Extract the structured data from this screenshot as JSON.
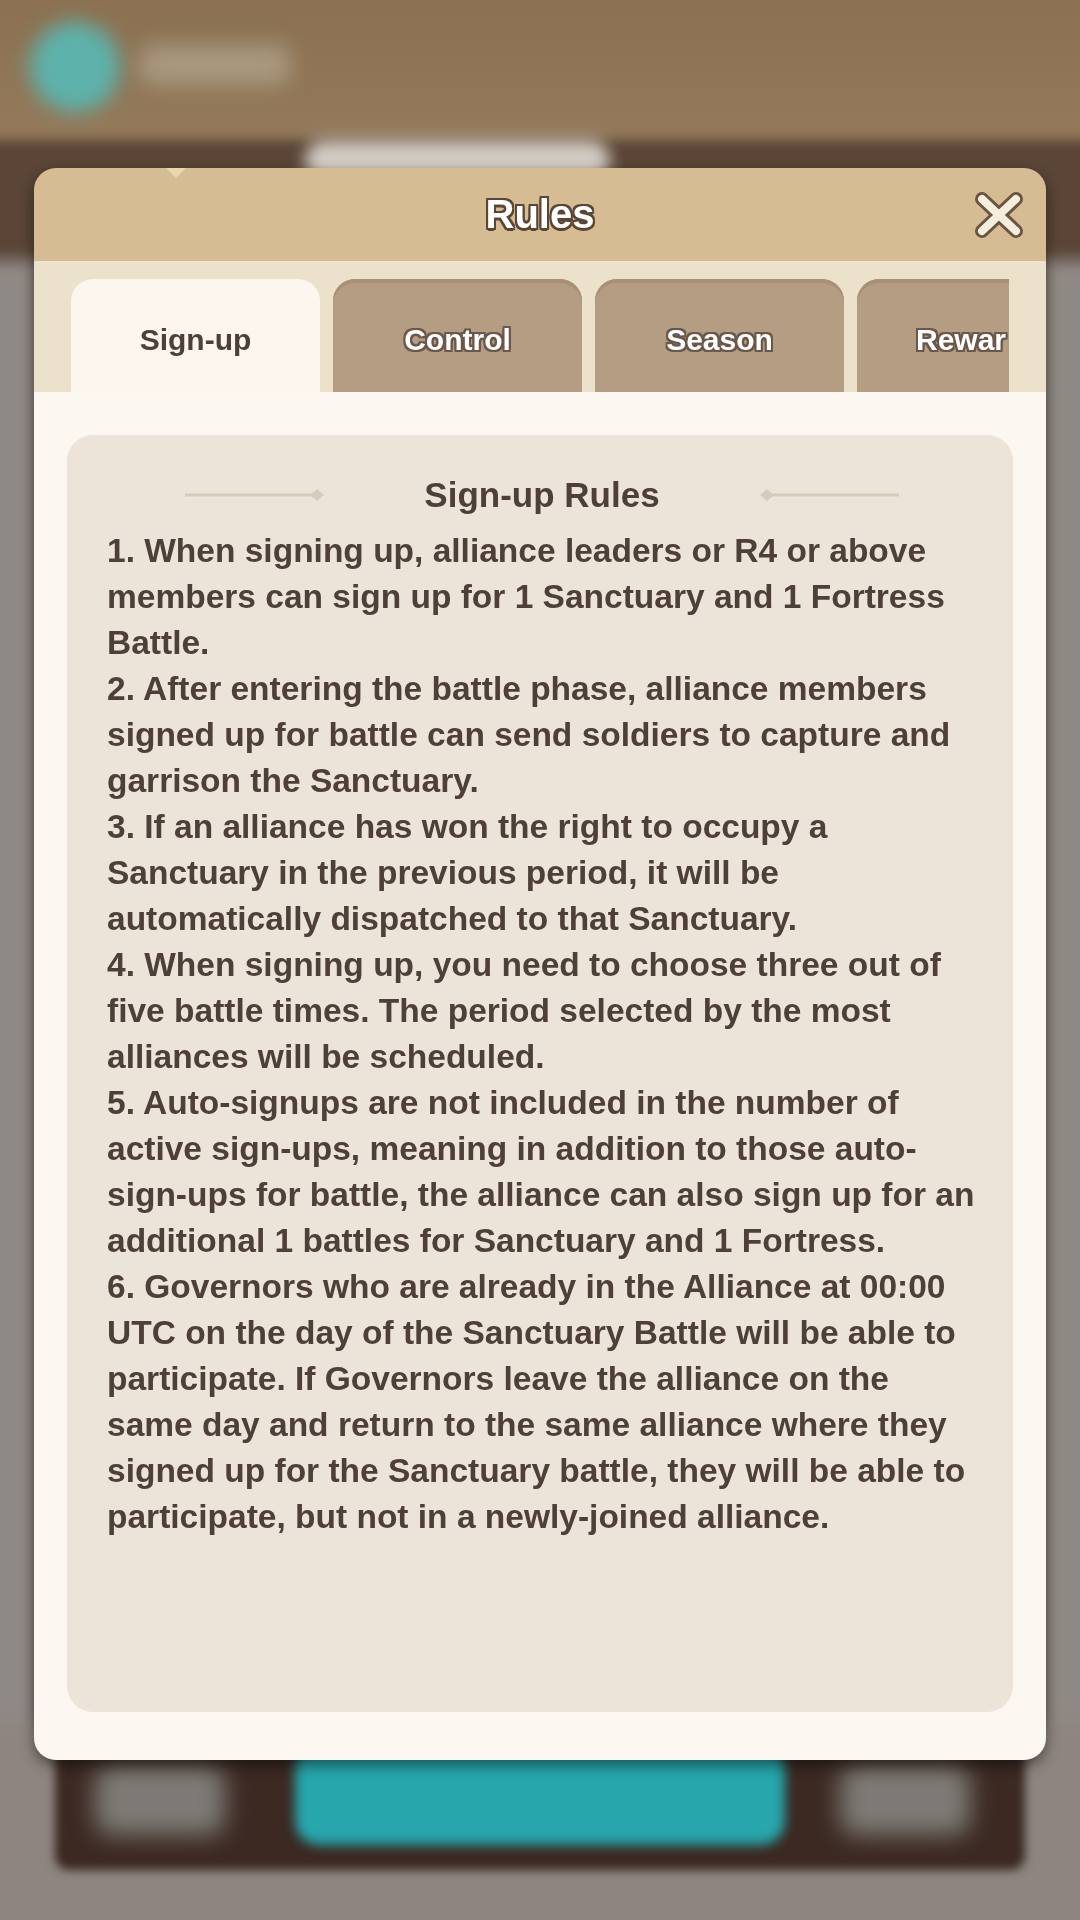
{
  "dialog": {
    "title": "Rules"
  },
  "tabs": [
    {
      "label": "Sign-up",
      "selected": true
    },
    {
      "label": "Control",
      "selected": false
    },
    {
      "label": "Season",
      "selected": false
    },
    {
      "label": "Rewar",
      "selected": false
    }
  ],
  "section": {
    "heading": "Sign-up Rules",
    "rules": [
      "1. When signing up, alliance leaders or R4 or above members can sign up for 1 Sanctuary and 1 Fortress Battle.",
      "2. After entering the battle phase, alliance members signed up for battle can send soldiers to capture and garrison the Sanctuary.",
      "3. If an alliance has won the right to occupy a Sanctuary in the previous period, it will be automatically dispatched to that Sanctuary.",
      "4. When signing up, you need to choose three out of five battle times. The period selected by the most alliances will be scheduled.",
      "5. Auto-signups are not included in the number of active sign-ups, meaning in addition to those auto-sign-ups for battle, the alliance can also sign up for an additional 1 battles for Sanctuary and 1 Fortress.",
      "6. Governors who are already in the Alliance at 00:00 UTC on the day of the Sanctuary Battle will be able to participate. If Governors leave the alliance on the same day and return to the same alliance where they signed up for the Sanctuary battle, they will be able to participate, but not in a newly-joined alliance."
    ]
  }
}
